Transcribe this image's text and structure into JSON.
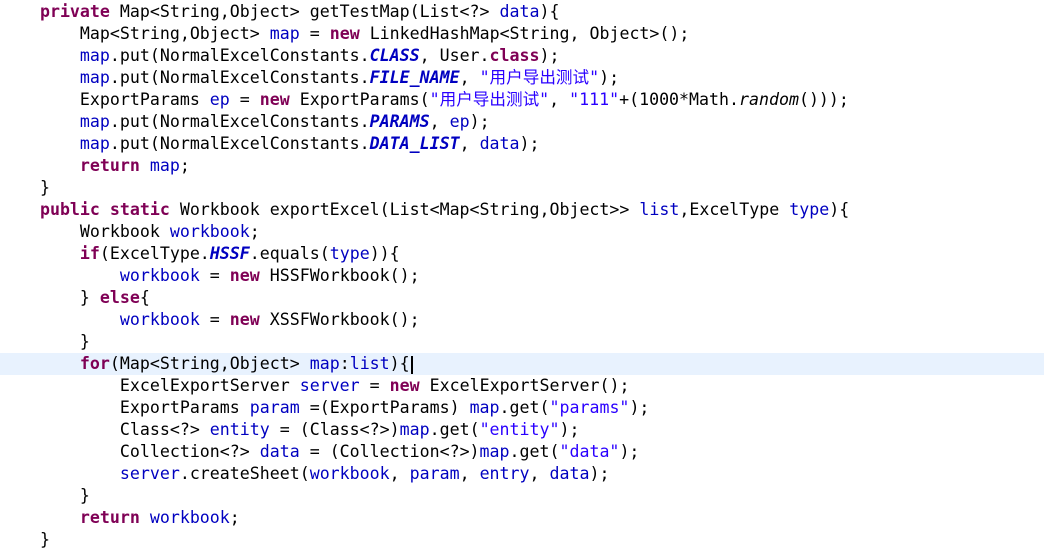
{
  "editor": {
    "current_line_index": 16,
    "lines": [
      [
        [
          "kw",
          "    private "
        ],
        [
          "p",
          "Map<String,Object> getTestMap(List<?> "
        ],
        [
          "fld",
          "data"
        ],
        [
          "p",
          "){"
        ]
      ],
      [
        [
          "p",
          "        Map<String,Object> "
        ],
        [
          "fld",
          "map"
        ],
        [
          "p",
          " = "
        ],
        [
          "kw",
          "new"
        ],
        [
          "p",
          " LinkedHashMap<String, Object>();"
        ]
      ],
      [
        [
          "fld",
          "        map"
        ],
        [
          "p",
          ".put(NormalExcelConstants."
        ],
        [
          "sfld",
          "CLASS"
        ],
        [
          "p",
          ", User."
        ],
        [
          "kw",
          "class"
        ],
        [
          "p",
          ");"
        ]
      ],
      [
        [
          "fld",
          "        map"
        ],
        [
          "p",
          ".put(NormalExcelConstants."
        ],
        [
          "sfld",
          "FILE_NAME"
        ],
        [
          "p",
          ", "
        ],
        [
          "str",
          "\"用户导出测试\""
        ],
        [
          "p",
          ");"
        ]
      ],
      [
        [
          "p",
          "        ExportParams "
        ],
        [
          "fld",
          "ep"
        ],
        [
          "p",
          " = "
        ],
        [
          "kw",
          "new"
        ],
        [
          "p",
          " ExportParams("
        ],
        [
          "str",
          "\"用户导出测试\""
        ],
        [
          "p",
          ", "
        ],
        [
          "str",
          "\"111\""
        ],
        [
          "p",
          "+(1000*Math."
        ],
        [
          "smth",
          "random"
        ],
        [
          "p",
          "()));"
        ]
      ],
      [
        [
          "fld",
          "        map"
        ],
        [
          "p",
          ".put(NormalExcelConstants."
        ],
        [
          "sfld",
          "PARAMS"
        ],
        [
          "p",
          ", "
        ],
        [
          "fld",
          "ep"
        ],
        [
          "p",
          ");"
        ]
      ],
      [
        [
          "fld",
          "        map"
        ],
        [
          "p",
          ".put(NormalExcelConstants."
        ],
        [
          "sfld",
          "DATA_LIST"
        ],
        [
          "p",
          ", "
        ],
        [
          "fld",
          "data"
        ],
        [
          "p",
          ");"
        ]
      ],
      [
        [
          "kw",
          "        return "
        ],
        [
          "fld",
          "map"
        ],
        [
          "p",
          ";"
        ]
      ],
      [
        [
          "p",
          "    }"
        ]
      ],
      [
        [
          "kw",
          "    public static "
        ],
        [
          "p",
          "Workbook exportExcel(List<Map<String,Object>> "
        ],
        [
          "fld",
          "list"
        ],
        [
          "p",
          ",ExcelType "
        ],
        [
          "fld",
          "type"
        ],
        [
          "p",
          "){"
        ]
      ],
      [
        [
          "p",
          "        Workbook "
        ],
        [
          "fld",
          "workbook"
        ],
        [
          "p",
          ";"
        ]
      ],
      [
        [
          "kw",
          "        if"
        ],
        [
          "p",
          "(ExcelType."
        ],
        [
          "sfld",
          "HSSF"
        ],
        [
          "p",
          ".equals("
        ],
        [
          "fld",
          "type"
        ],
        [
          "p",
          ")){"
        ]
      ],
      [
        [
          "fld",
          "            workbook"
        ],
        [
          "p",
          " = "
        ],
        [
          "kw",
          "new"
        ],
        [
          "p",
          " HSSFWorkbook();"
        ]
      ],
      [
        [
          "p",
          "        } "
        ],
        [
          "kw",
          "else"
        ],
        [
          "p",
          "{"
        ]
      ],
      [
        [
          "fld",
          "            workbook"
        ],
        [
          "p",
          " = "
        ],
        [
          "kw",
          "new"
        ],
        [
          "p",
          " XSSFWorkbook();"
        ]
      ],
      [
        [
          "p",
          "        }"
        ]
      ],
      [
        [
          "kw",
          "        for"
        ],
        [
          "p",
          "(Map<String,Object> "
        ],
        [
          "fld",
          "map"
        ],
        [
          "p",
          ":"
        ],
        [
          "fld",
          "list"
        ],
        [
          "p",
          "){"
        ]
      ],
      [
        [
          "p",
          "            ExcelExportServer "
        ],
        [
          "fld",
          "server"
        ],
        [
          "p",
          " = "
        ],
        [
          "kw",
          "new"
        ],
        [
          "p",
          " ExcelExportServer();"
        ]
      ],
      [
        [
          "p",
          "            ExportParams "
        ],
        [
          "fld",
          "param"
        ],
        [
          "p",
          " =(ExportParams) "
        ],
        [
          "fld",
          "map"
        ],
        [
          "p",
          ".get("
        ],
        [
          "str",
          "\"params\""
        ],
        [
          "p",
          ");"
        ]
      ],
      [
        [
          "p",
          "            Class<?> "
        ],
        [
          "fld",
          "entity"
        ],
        [
          "p",
          " = (Class<?>)"
        ],
        [
          "fld",
          "map"
        ],
        [
          "p",
          ".get("
        ],
        [
          "str",
          "\"entity\""
        ],
        [
          "p",
          ");"
        ]
      ],
      [
        [
          "p",
          "            Collection<?> "
        ],
        [
          "fld",
          "data"
        ],
        [
          "p",
          " = (Collection<?>)"
        ],
        [
          "fld",
          "map"
        ],
        [
          "p",
          ".get("
        ],
        [
          "str",
          "\"data\""
        ],
        [
          "p",
          ");"
        ]
      ],
      [
        [
          "fld",
          "            server"
        ],
        [
          "p",
          ".createSheet("
        ],
        [
          "fld",
          "workbook"
        ],
        [
          "p",
          ", "
        ],
        [
          "fld",
          "param"
        ],
        [
          "p",
          ", "
        ],
        [
          "fld",
          "entry"
        ],
        [
          "p",
          ", "
        ],
        [
          "fld",
          "data"
        ],
        [
          "p",
          ");"
        ]
      ],
      [
        [
          "p",
          "        }"
        ]
      ],
      [
        [
          "kw",
          "        return "
        ],
        [
          "fld",
          "workbook"
        ],
        [
          "p",
          ";"
        ]
      ],
      [
        [
          "p",
          "    }"
        ]
      ]
    ]
  }
}
